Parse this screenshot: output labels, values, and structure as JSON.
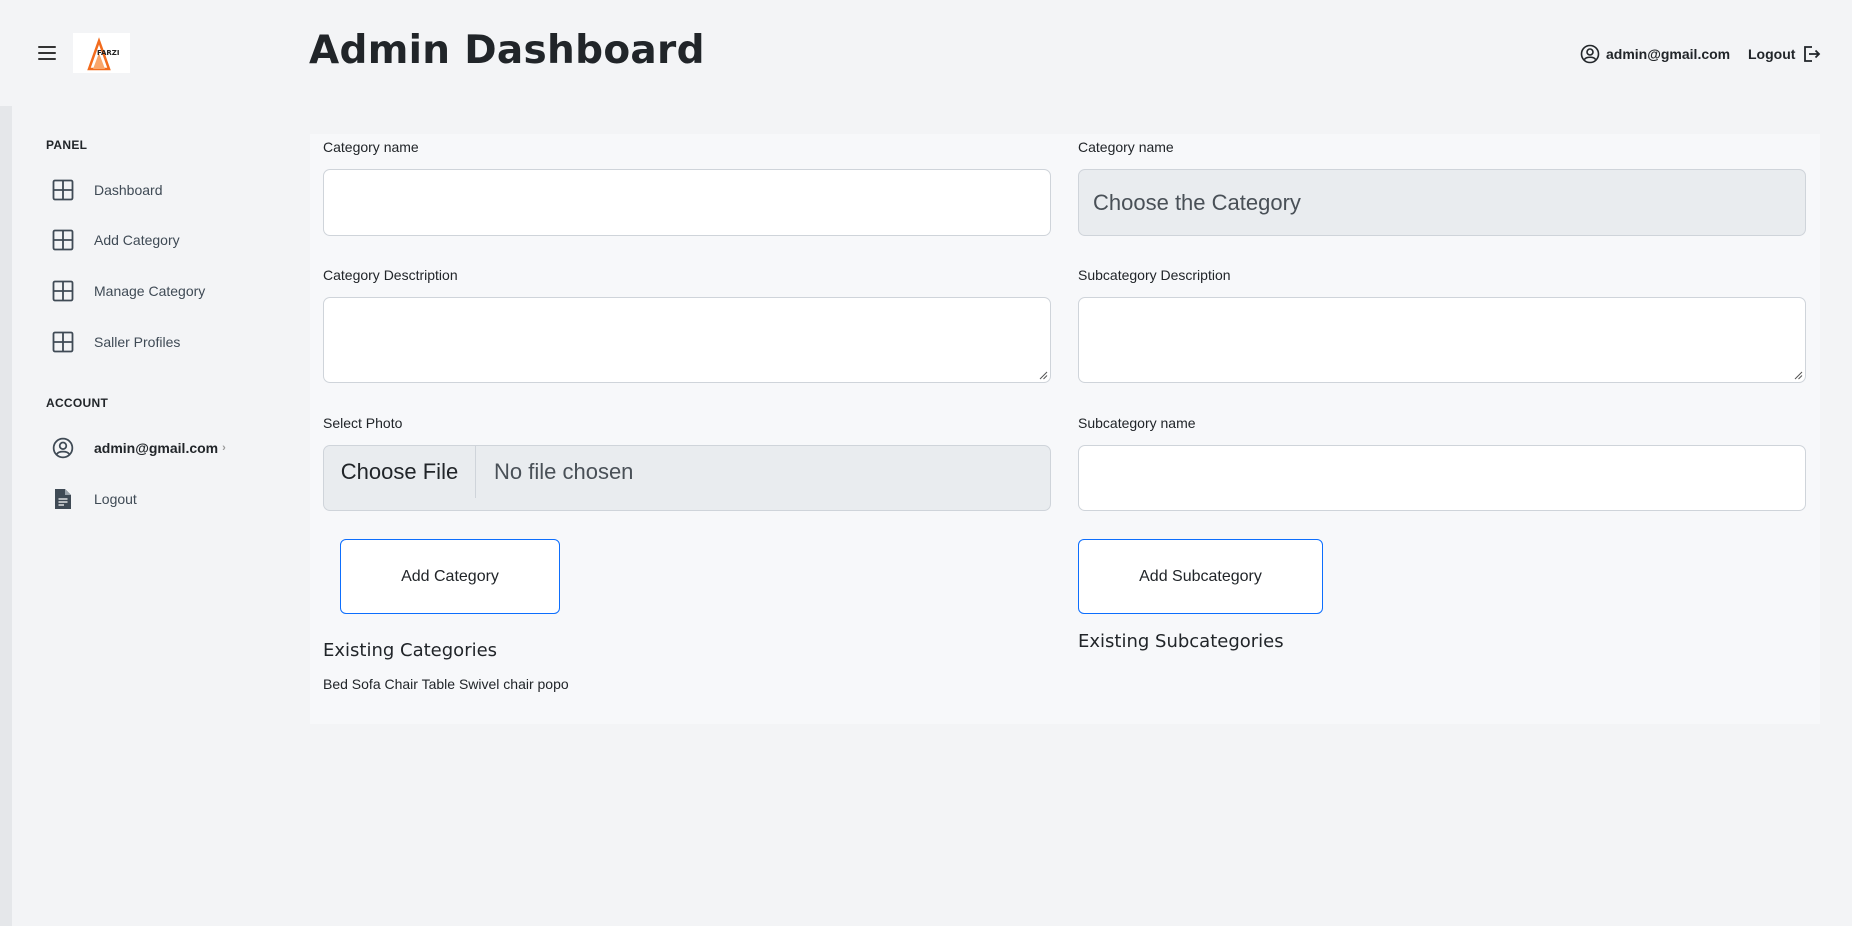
{
  "header": {
    "title": "Admin Dashboard",
    "logo_text": "FARZI",
    "user_email": "admin@gmail.com",
    "logout_label": "Logout"
  },
  "sidebar": {
    "panel_label": "PANEL",
    "panel_items": [
      {
        "label": "Dashboard",
        "icon": "grid-icon"
      },
      {
        "label": "Add Category",
        "icon": "grid-icon"
      },
      {
        "label": "Manage Category",
        "icon": "grid-icon"
      },
      {
        "label": "Saller Profiles",
        "icon": "grid-icon"
      }
    ],
    "account_label": "ACCOUNT",
    "account_email": "admin@gmail.com",
    "account_logout": "Logout"
  },
  "category_form": {
    "name_label": "Category name",
    "name_value": "",
    "description_label": "Category Desctription",
    "description_value": "",
    "photo_label": "Select Photo",
    "file_button": "Choose File",
    "file_status": "No file chosen",
    "submit_label": "Add Category",
    "existing_heading": "Existing Categories",
    "existing_list": "Bed Sofa Chair Table Swivel chair popo"
  },
  "subcategory_form": {
    "category_label": "Category name",
    "category_select": "Choose the Category",
    "description_label": "Subcategory Description",
    "description_value": "",
    "name_label": "Subcategory name",
    "name_value": "",
    "submit_label": "Add Subcategory",
    "existing_heading": "Existing Subcategories"
  },
  "colors": {
    "accent": "#0d6efd",
    "logo_accent": "#f26b1d"
  }
}
